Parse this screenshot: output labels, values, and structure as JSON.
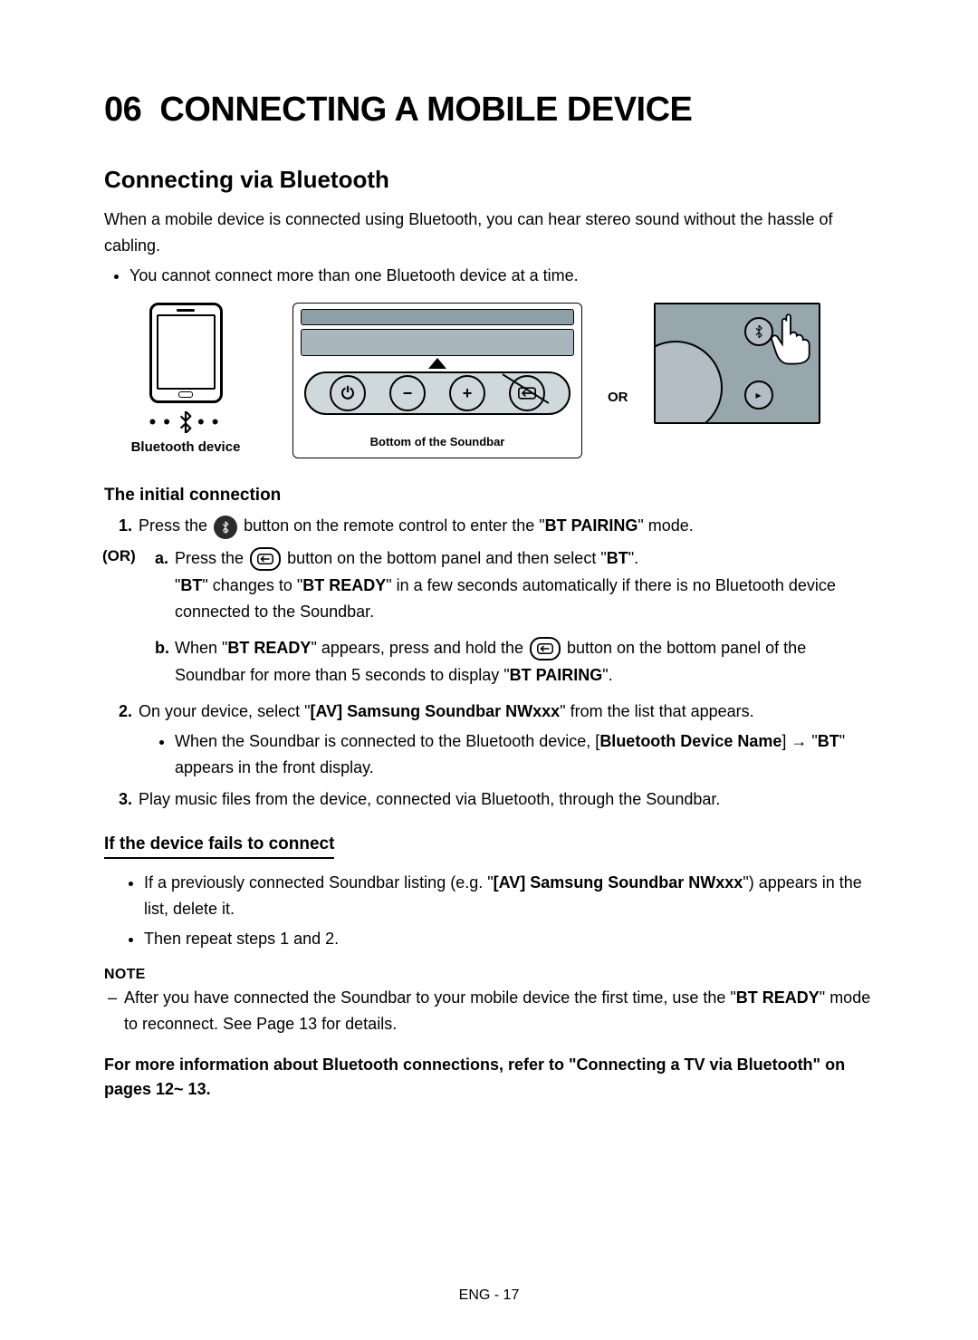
{
  "section": {
    "number": "06",
    "title": "CONNECTING A MOBILE DEVICE"
  },
  "subsection": {
    "title": "Connecting via Bluetooth",
    "intro": "When a mobile device is connected using Bluetooth, you can hear stereo sound without the hassle of cabling.",
    "bullet1": "You cannot connect more than one Bluetooth device at a time."
  },
  "diagram": {
    "phone_label": "Bluetooth device",
    "soundbar_label": "Bottom of the Soundbar",
    "or_label": "OR"
  },
  "initial": {
    "heading": "The initial connection",
    "step1_pre": "Press the ",
    "step1_post": " button on the remote control to enter the \"",
    "step1_mode": "BT PAIRING",
    "step1_post2": "\" mode.",
    "or_label": "(OR)",
    "a_pre": "Press the ",
    "a_mid": " button on the bottom panel and then select \"",
    "a_bt": "BT",
    "a_post": "\".",
    "a_line2_pre": "\"",
    "a_line2_bt": "BT",
    "a_line2_mid": "\" changes to \"",
    "a_line2_ready": "BT READY",
    "a_line2_post": "\" in a few seconds automatically if there is no Bluetooth device connected to the Soundbar.",
    "b_pre": "When \"",
    "b_ready": "BT READY",
    "b_mid": "\" appears, press and hold the ",
    "b_post": " button on the bottom panel of the Soundbar for more than 5 seconds to display \"",
    "b_pairing": "BT PAIRING",
    "b_end": "\".",
    "step2_pre": "On your device, select \"",
    "step2_name": "[AV] Samsung Soundbar NWxxx",
    "step2_post": "\" from the list that appears.",
    "step2_sub_pre": "When the Soundbar is connected to the Bluetooth device, [",
    "step2_sub_dev": "Bluetooth Device Name",
    "step2_sub_mid": "] → \"",
    "step2_sub_bt": "BT",
    "step2_sub_post": "\" appears in the front display.",
    "step3": "Play music files from the device, connected via Bluetooth, through the Soundbar."
  },
  "fails": {
    "heading": "If the device fails to connect",
    "b1_pre": "If a previously connected Soundbar listing (e.g. \"",
    "b1_name": "[AV] Samsung Soundbar NWxxx",
    "b1_post": "\") appears in the list, delete it.",
    "b2": "Then repeat steps 1 and 2."
  },
  "note": {
    "label": "NOTE",
    "dash1_pre": "After you have connected the Soundbar to your mobile device the first time, use the \"",
    "dash1_ready": "BT READY",
    "dash1_post": "\" mode to reconnect. See Page 13 for details."
  },
  "more_info": "For more information about Bluetooth connections, refer to \"Connecting a TV via Bluetooth\" on pages 12~ 13.",
  "footer": "ENG - 17"
}
